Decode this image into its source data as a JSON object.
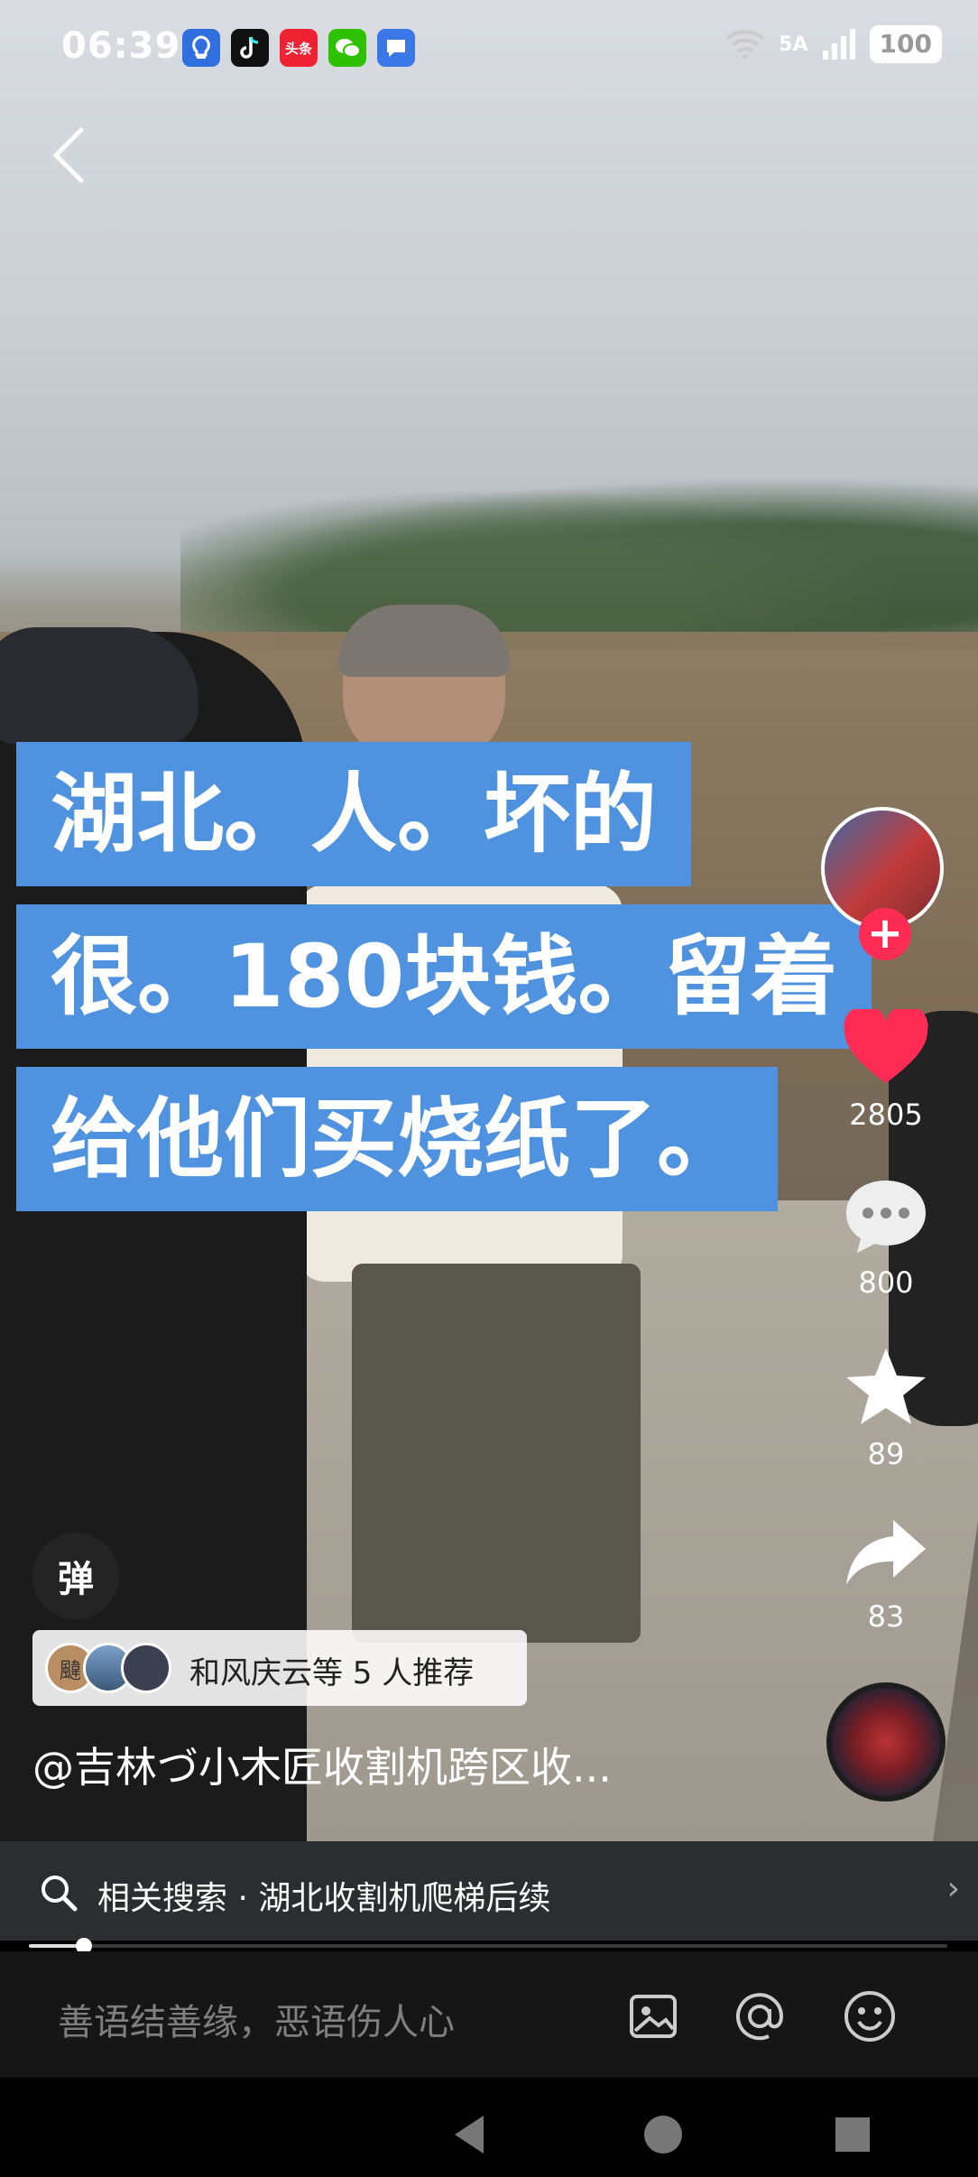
{
  "status_bar": {
    "time": "06:39",
    "notifications": [
      "tips-icon",
      "tiktok-icon",
      "toutiao-icon",
      "wechat-icon",
      "message-icon"
    ],
    "toutiao_label": "头条",
    "network": "5A",
    "battery": "100"
  },
  "caption_lines": [
    "湖北。人。坏的",
    "很。180块钱。留着",
    "给他们买烧纸了。"
  ],
  "actions": {
    "likes": "2805",
    "comments": "800",
    "favorites": "89",
    "shares": "83"
  },
  "danmaku_label": "弹",
  "recommend": {
    "first_avatar_label": "颹",
    "text": "和风庆云等 5 人推荐"
  },
  "author": "@吉林づ小木匠收割机跨区收...",
  "related_search": "相关搜索 · 湖北收割机爬梯后续",
  "progress": 0.06,
  "comment_placeholder": "善语结善缘，恶语伤人心",
  "colors": {
    "caption_bg": "#4f93e0",
    "like": "#fe2c55"
  }
}
